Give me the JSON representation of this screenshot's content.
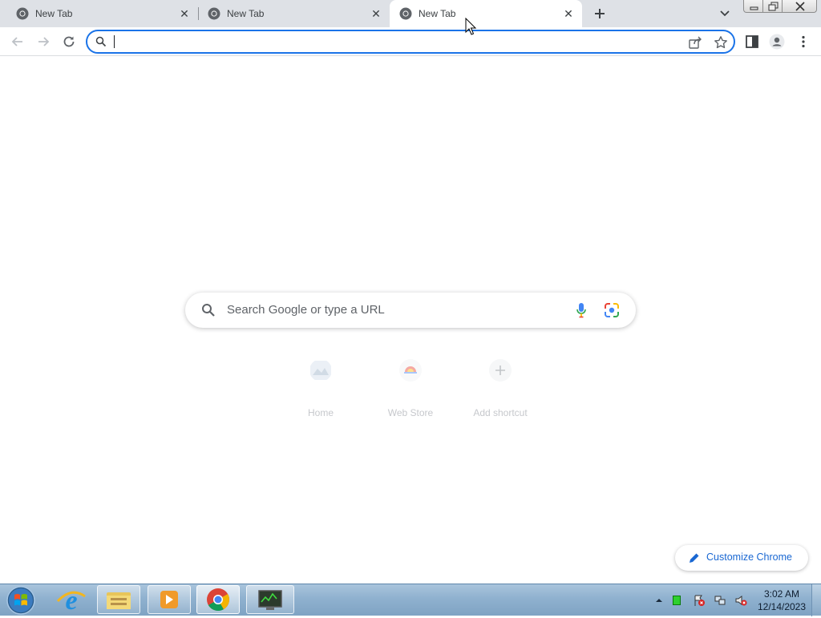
{
  "browser": {
    "tabs": [
      {
        "title": "New Tab",
        "active": false,
        "favicon": "chrome-icon"
      },
      {
        "title": "New Tab",
        "active": false,
        "favicon": "chrome-icon"
      },
      {
        "title": "New Tab",
        "active": true,
        "favicon": "chrome-icon"
      }
    ],
    "new_tab_icon": "plus-icon",
    "tab_search_icon": "chevron-down-icon",
    "omnibox": {
      "value": "",
      "placeholder": ""
    },
    "accent_color": "#1a73e8"
  },
  "ntp": {
    "search_placeholder": "Search Google or type a URL",
    "shortcuts": [
      {
        "label": "Home",
        "icon": "home-site-icon"
      },
      {
        "label": "Web Store",
        "icon": "web-store-icon"
      },
      {
        "label": "Add shortcut",
        "icon": "plus-icon"
      }
    ],
    "customize_label": "Customize Chrome",
    "customize_color": "#1967d2"
  },
  "taskbar": {
    "pinned": [
      "internet-explorer-icon",
      "file-explorer-icon",
      "media-player-icon",
      "chrome-icon",
      "system-monitor-icon"
    ],
    "clock_time": "3:02 AM",
    "clock_date": "12/14/2023"
  }
}
